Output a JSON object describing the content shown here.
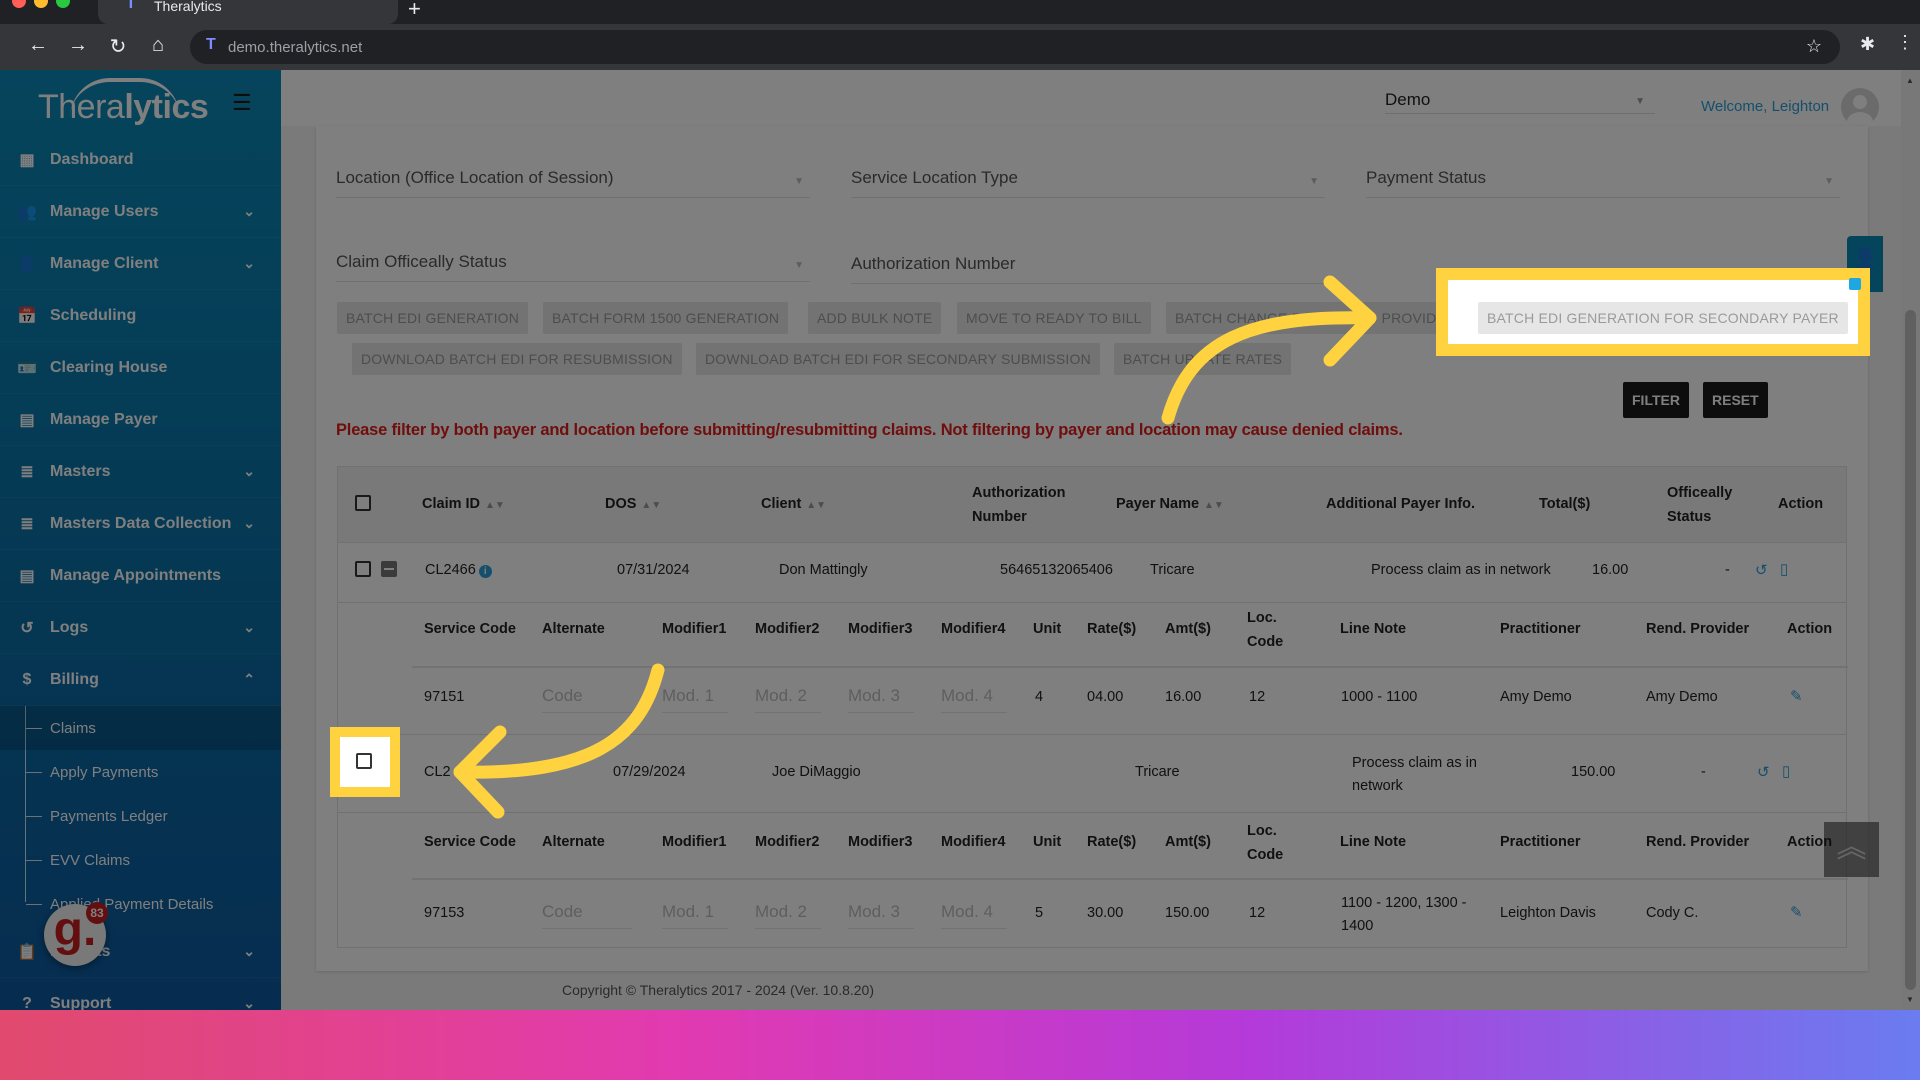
{
  "browser": {
    "tab_title": "Theralytics",
    "url": "demo.theralytics.net",
    "new_tab_label": "+"
  },
  "sidebar": {
    "logo_light": "Thera",
    "logo_bold": "lytics",
    "items": [
      {
        "label": "Dashboard",
        "icon": "dashboard-icon",
        "glyph": "▦",
        "expandable": false
      },
      {
        "label": "Manage Users",
        "icon": "users-icon",
        "glyph": "👥",
        "expandable": true
      },
      {
        "label": "Manage Client",
        "icon": "user-icon",
        "glyph": "👤",
        "expandable": true
      },
      {
        "label": "Scheduling",
        "icon": "calendar-icon",
        "glyph": "📅",
        "expandable": false
      },
      {
        "label": "Clearing House",
        "icon": "contact-card-icon",
        "glyph": "🪪",
        "expandable": false
      },
      {
        "label": "Manage Payer",
        "icon": "payer-icon",
        "glyph": "▤",
        "expandable": false
      },
      {
        "label": "Masters",
        "icon": "database-icon",
        "glyph": "≣",
        "expandable": true
      },
      {
        "label": "Masters Data Collection",
        "icon": "database-icon",
        "glyph": "≣",
        "expandable": true
      },
      {
        "label": "Manage Appointments",
        "icon": "appointments-icon",
        "glyph": "▤",
        "expandable": false
      },
      {
        "label": "Logs",
        "icon": "history-icon",
        "glyph": "↺",
        "expandable": true
      },
      {
        "label": "Billing",
        "icon": "dollar-icon",
        "glyph": "$",
        "expandable": true,
        "expanded": true
      }
    ],
    "billing_sub": [
      "Claims",
      "Apply Payments",
      "Payments Ledger",
      "EVV Claims",
      "Applied Payment Details"
    ],
    "active_sub": "Claims",
    "after_items": [
      {
        "label": "Reports",
        "icon": "clipboard-icon",
        "glyph": "📋",
        "expandable": true
      },
      {
        "label": "Support",
        "icon": "help-icon",
        "glyph": "?",
        "expandable": true
      }
    ],
    "chevron_down": "⌄",
    "chevron_up": "⌃"
  },
  "header": {
    "org_value": "Demo",
    "welcome": "Welcome, Leighton"
  },
  "filters": {
    "location": "Location (Office Location of Session)",
    "service_location_type": "Service Location Type",
    "payment_status": "Payment Status",
    "claim_status": "Claim Officeally Status",
    "authorization_number": "Authorization Number"
  },
  "actions": {
    "row1": [
      "BATCH EDI GENERATION",
      "BATCH FORM 1500 GENERATION",
      "ADD BULK NOTE",
      "MOVE TO READY TO BILL",
      "BATCH CHANGE RENDERING PROVIDER",
      "BATCH EDI GENERATION FOR SECONDARY PAYER"
    ],
    "row2": [
      "DOWNLOAD BATCH EDI FOR RESUBMISSION",
      "DOWNLOAD BATCH EDI FOR SECONDARY SUBMISSION",
      "BATCH UPDATE RATES"
    ],
    "filter": "FILTER",
    "reset": "RESET"
  },
  "warning": "Please filter by both payer and location before submitting/resubmitting claims. Not filtering by payer and location may cause denied claims.",
  "table": {
    "headers": {
      "claim_id": "Claim ID",
      "dos": "DOS",
      "client": "Client",
      "authorization_number": "Authorization Number",
      "payer_name": "Payer Name",
      "additional_payer_info": "Additional Payer Info.",
      "total": "Total($)",
      "officeally_status": "Officeally Status",
      "action": "Action"
    },
    "line_headers": {
      "service_code": "Service Code",
      "alternate": "Alternate",
      "modifier1": "Modifier1",
      "modifier2": "Modifier2",
      "modifier3": "Modifier3",
      "modifier4": "Modifier4",
      "unit": "Unit",
      "rate": "Rate($)",
      "amt": "Amt($)",
      "loc_code": "Loc. Code",
      "line_note": "Line Note",
      "practitioner": "Practitioner",
      "rend_provider": "Rend. Provider",
      "action": "Action"
    },
    "placeholders": {
      "alternate": "Code",
      "mod1": "Mod. 1",
      "mod2": "Mod. 2",
      "mod3": "Mod. 3",
      "mod4": "Mod. 4"
    },
    "claims": [
      {
        "claim_id": "CL2466",
        "dos": "07/31/2024",
        "client": "Don Mattingly",
        "authorization_number": "56465132065406",
        "payer_name": "Tricare",
        "additional_payer_info": "Process claim as in network",
        "total": "16.00",
        "officeally_status": "-",
        "line": {
          "service_code": "97151",
          "unit": "4",
          "rate": "04.00",
          "amt": "16.00",
          "loc_code": "12",
          "line_note": "1000 - 1100",
          "practitioner": "Amy Demo",
          "rend_provider": "Amy Demo"
        }
      },
      {
        "claim_id": "CL2",
        "dos": "07/29/2024",
        "client": "Joe DiMaggio",
        "authorization_number": "",
        "payer_name": "Tricare",
        "additional_payer_info": "Process claim as in network",
        "total": "150.00",
        "officeally_status": "-",
        "line": {
          "service_code": "97153",
          "unit": "5",
          "rate": "30.00",
          "amt": "150.00",
          "loc_code": "12",
          "line_note": "1100 - 1200, 1300 - 1400",
          "practitioner": "Leighton Davis",
          "rend_provider": "Cody C."
        }
      }
    ]
  },
  "footer": "Copyright © Theralytics 2017 - 2024 (Ver. 10.8.20)",
  "widgets": {
    "notification_count": "83",
    "notification_letter": "g."
  },
  "colors": {
    "sidebar": "#0b8ab8",
    "accent": "#2a9fd6",
    "warning": "#e01b1b",
    "highlight": "#ffd23f"
  }
}
